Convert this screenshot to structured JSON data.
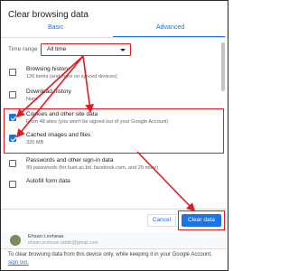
{
  "dialog": {
    "title": "Clear browsing data",
    "tabs": [
      {
        "label": "Basic",
        "active": false
      },
      {
        "label": "Advanced",
        "active": true
      }
    ]
  },
  "time_range": {
    "label": "Time range",
    "value": "All time"
  },
  "items": [
    {
      "title": "Browsing history",
      "subtitle": "126 items (and more on synced devices)",
      "checked": false
    },
    {
      "title": "Download history",
      "subtitle": "None",
      "checked": false
    },
    {
      "title": "Cookies and other site data",
      "subtitle": "From 48 sites (you won't be signed out of your Google Account)",
      "checked": true
    },
    {
      "title": "Cached images and files",
      "subtitle": "320 MB",
      "checked": true
    },
    {
      "title": "Passwords and other sign-in data",
      "subtitle": "99 passwords (for kuet.ac.bd, facebook.com, and 29 more)",
      "checked": false
    },
    {
      "title": "Autofill form data",
      "subtitle": "",
      "checked": false
    }
  ],
  "buttons": {
    "cancel": "Cancel",
    "clear": "Clear data"
  },
  "account": {
    "name": "Ehsan Lnoheaa",
    "email": "ehsan.w.ehsan.uddin@gmail.com"
  },
  "footer": {
    "text": "To clear browsing data from this device only, while keeping it in your Google Account,",
    "link": "sign out."
  },
  "colors": {
    "accent": "#1a73e8",
    "annotation": "#e11b22"
  }
}
